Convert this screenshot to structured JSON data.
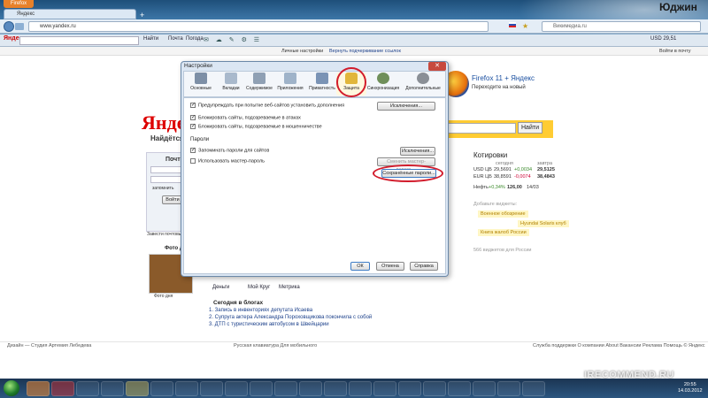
{
  "browser": {
    "app_button": "Firefox",
    "tab_title": "Яндекс",
    "url": "www.yandex.ru",
    "search_placeholder": "Викимедиа.ru",
    "user_name": "Юджин",
    "toolbar": {
      "logo": "Яндекс",
      "find": "Найти",
      "mail": "Почта",
      "items": [
        "Найти",
        "Почта",
        "Погода"
      ]
    },
    "page_links": {
      "personal": "Личные настройки",
      "restore": "Вернуть подчеркивание ссылок",
      "login": "Войти в почту"
    }
  },
  "page": {
    "logo": "Яндекс",
    "tagline": "Найдётся всё",
    "ff_promo_title": "Firefox 11 + Яндекс",
    "ff_promo_sub": "Переходите на новый",
    "search_button": "Найти",
    "quotes": {
      "title": "Котировки",
      "head": [
        "сегодня",
        "завтра"
      ],
      "rows": [
        [
          "USD ЦБ",
          "29,5691",
          "+0,0034",
          "29,5125"
        ],
        [
          "EUR ЦБ",
          "38,8591",
          "-0,0074",
          "38,4843"
        ],
        [
          "Нефть",
          "+0,34%",
          "126,00",
          "14/03"
        ]
      ]
    },
    "widgets": {
      "title": "Добавьте виджеты:",
      "items": [
        "Военное обозрение",
        "Hyundai Solaris клуб",
        "Книга жалоб России"
      ],
      "more": "566 виджетов для России"
    },
    "mail_box": {
      "title": "Почта",
      "login_btn": "Войти",
      "remember": "запомнить",
      "make_mail": "Завести почтовый ящик"
    },
    "photo_day": "Фото дня",
    "services": [
      "Деньги",
      "Мой Круг",
      "Метрика"
    ],
    "blogs_title": "Сегодня в блогах",
    "blogs": [
      "1. Запись в инвенториях депутата Исаева",
      "2. Супруга актера Александра Пороховщикова покончила с собой",
      "3. ДТП с туристическим автобусом в Швейцарии"
    ],
    "footer": {
      "left": "Дизайн — Студия Артемия Лебедева",
      "middle": "Русская клавиатура   Для мобильного",
      "right": "Служба поддержки  О компании  About  Вакансии  Реклама  Помощь  © Яндекс"
    }
  },
  "dialog": {
    "title": "Настройки",
    "close": "✕",
    "tabs": [
      {
        "label": "Основные",
        "icon": "switch-icon",
        "color": "#7d8fa6"
      },
      {
        "label": "Вкладки",
        "icon": "tabs-icon",
        "color": "#a9b9cc"
      },
      {
        "label": "Содержимое",
        "icon": "page-icon",
        "color": "#8fa0b4"
      },
      {
        "label": "Приложения",
        "icon": "apps-icon",
        "color": "#9fb3c9"
      },
      {
        "label": "Приватность",
        "icon": "mask-icon",
        "color": "#7a93b5"
      },
      {
        "label": "Защита",
        "icon": "lock-icon",
        "color": "#e1b63a"
      },
      {
        "label": "Синхронизация",
        "icon": "sync-icon",
        "color": "#6f8f5a"
      },
      {
        "label": "Дополнительные",
        "icon": "gear-icon",
        "color": "#8a8f96"
      }
    ],
    "checks": [
      {
        "label": "Предупреждать при попытке веб-сайтов установить дополнения",
        "checked": true
      },
      {
        "label": "Блокировать сайты, подозреваемые в атаках",
        "checked": true
      },
      {
        "label": "Блокировать сайты, подозреваемые в мошенничестве",
        "checked": true
      }
    ],
    "passwords_group": "Пароли",
    "pw_checks": [
      {
        "label": "Запоминать пароли для сайтов",
        "checked": true
      },
      {
        "label": "Использовать мастер-пароль",
        "checked": false
      }
    ],
    "buttons": {
      "exceptions1": "Исключения...",
      "exceptions2": "Исключения...",
      "change_master": "Сменить мастер-пароль...",
      "saved_passwords": "Сохранённые пароли...",
      "ok": "ОК",
      "cancel": "Отмена",
      "help": "Справка"
    }
  },
  "taskbar": {
    "clock_time": "20:55",
    "clock_date": "14.03.2012",
    "watermark": "IRECOMMEND.RU"
  }
}
